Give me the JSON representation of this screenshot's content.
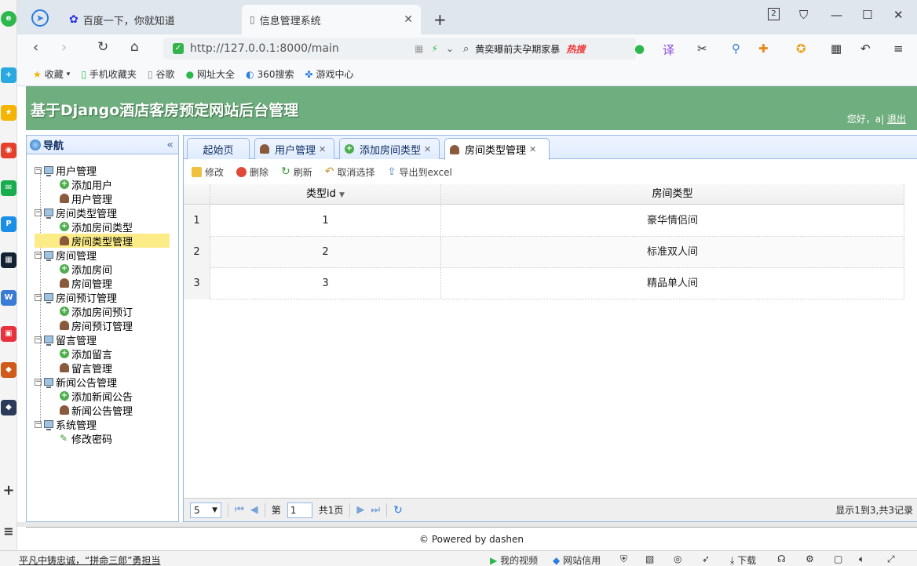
{
  "browser": {
    "tabs": [
      {
        "title": "百度一下，你就知道",
        "active": false
      },
      {
        "title": "信息管理系统",
        "active": true
      }
    ],
    "new_tab": "+",
    "window_badge": "2",
    "url": "http://127.0.0.1:8000/main",
    "search_text": "黄奕曝前夫孕期家暴",
    "search_hot": "热搜",
    "bookmarks": [
      "收藏",
      "手机收藏夹",
      "谷歌",
      "网址大全",
      "360搜索",
      "游戏中心"
    ]
  },
  "app": {
    "title": "基于Django酒店客房预定网站后台管理",
    "greeting": "您好，a|",
    "logout": "退出"
  },
  "nav": {
    "title": "导航",
    "groups": [
      {
        "label": "用户管理",
        "items": [
          "添加用户",
          "用户管理"
        ]
      },
      {
        "label": "房间类型管理",
        "items": [
          "添加房间类型",
          "房间类型管理"
        ]
      },
      {
        "label": "房间管理",
        "items": [
          "添加房间",
          "房间管理"
        ]
      },
      {
        "label": "房间预订管理",
        "items": [
          "添加房间预订",
          "房间预订管理"
        ]
      },
      {
        "label": "留言管理",
        "items": [
          "添加留言",
          "留言管理"
        ]
      },
      {
        "label": "新闻公告管理",
        "items": [
          "添加新闻公告",
          "新闻公告管理"
        ]
      },
      {
        "label": "系统管理",
        "items": [
          "修改密码"
        ]
      }
    ],
    "selected": "房间类型管理"
  },
  "tabs": [
    {
      "label": "起始页",
      "closable": false
    },
    {
      "label": "用户管理",
      "closable": true
    },
    {
      "label": "添加房间类型",
      "closable": true
    },
    {
      "label": "房间类型管理",
      "closable": true,
      "active": true
    }
  ],
  "toolbar": {
    "edit": "修改",
    "delete": "删除",
    "refresh": "刷新",
    "unselect": "取消选择",
    "export": "导出到excel"
  },
  "grid": {
    "columns": [
      "类型id",
      "房间类型"
    ],
    "rows": [
      {
        "num": "1",
        "id": "1",
        "type": "豪华情侣间"
      },
      {
        "num": "2",
        "id": "2",
        "type": "标准双人间"
      },
      {
        "num": "3",
        "id": "3",
        "type": "精品单人间"
      }
    ]
  },
  "pager": {
    "page_size": "5",
    "page_prefix": "第",
    "page_value": "1",
    "page_total": "共1页",
    "info": "显示1到3,共3记录"
  },
  "footer": "© Powered by dashen",
  "status": {
    "news": "平凡中铸忠诚，“拼命三郎”勇担当",
    "items": [
      "我的视频",
      "网站信用",
      "下载"
    ]
  }
}
